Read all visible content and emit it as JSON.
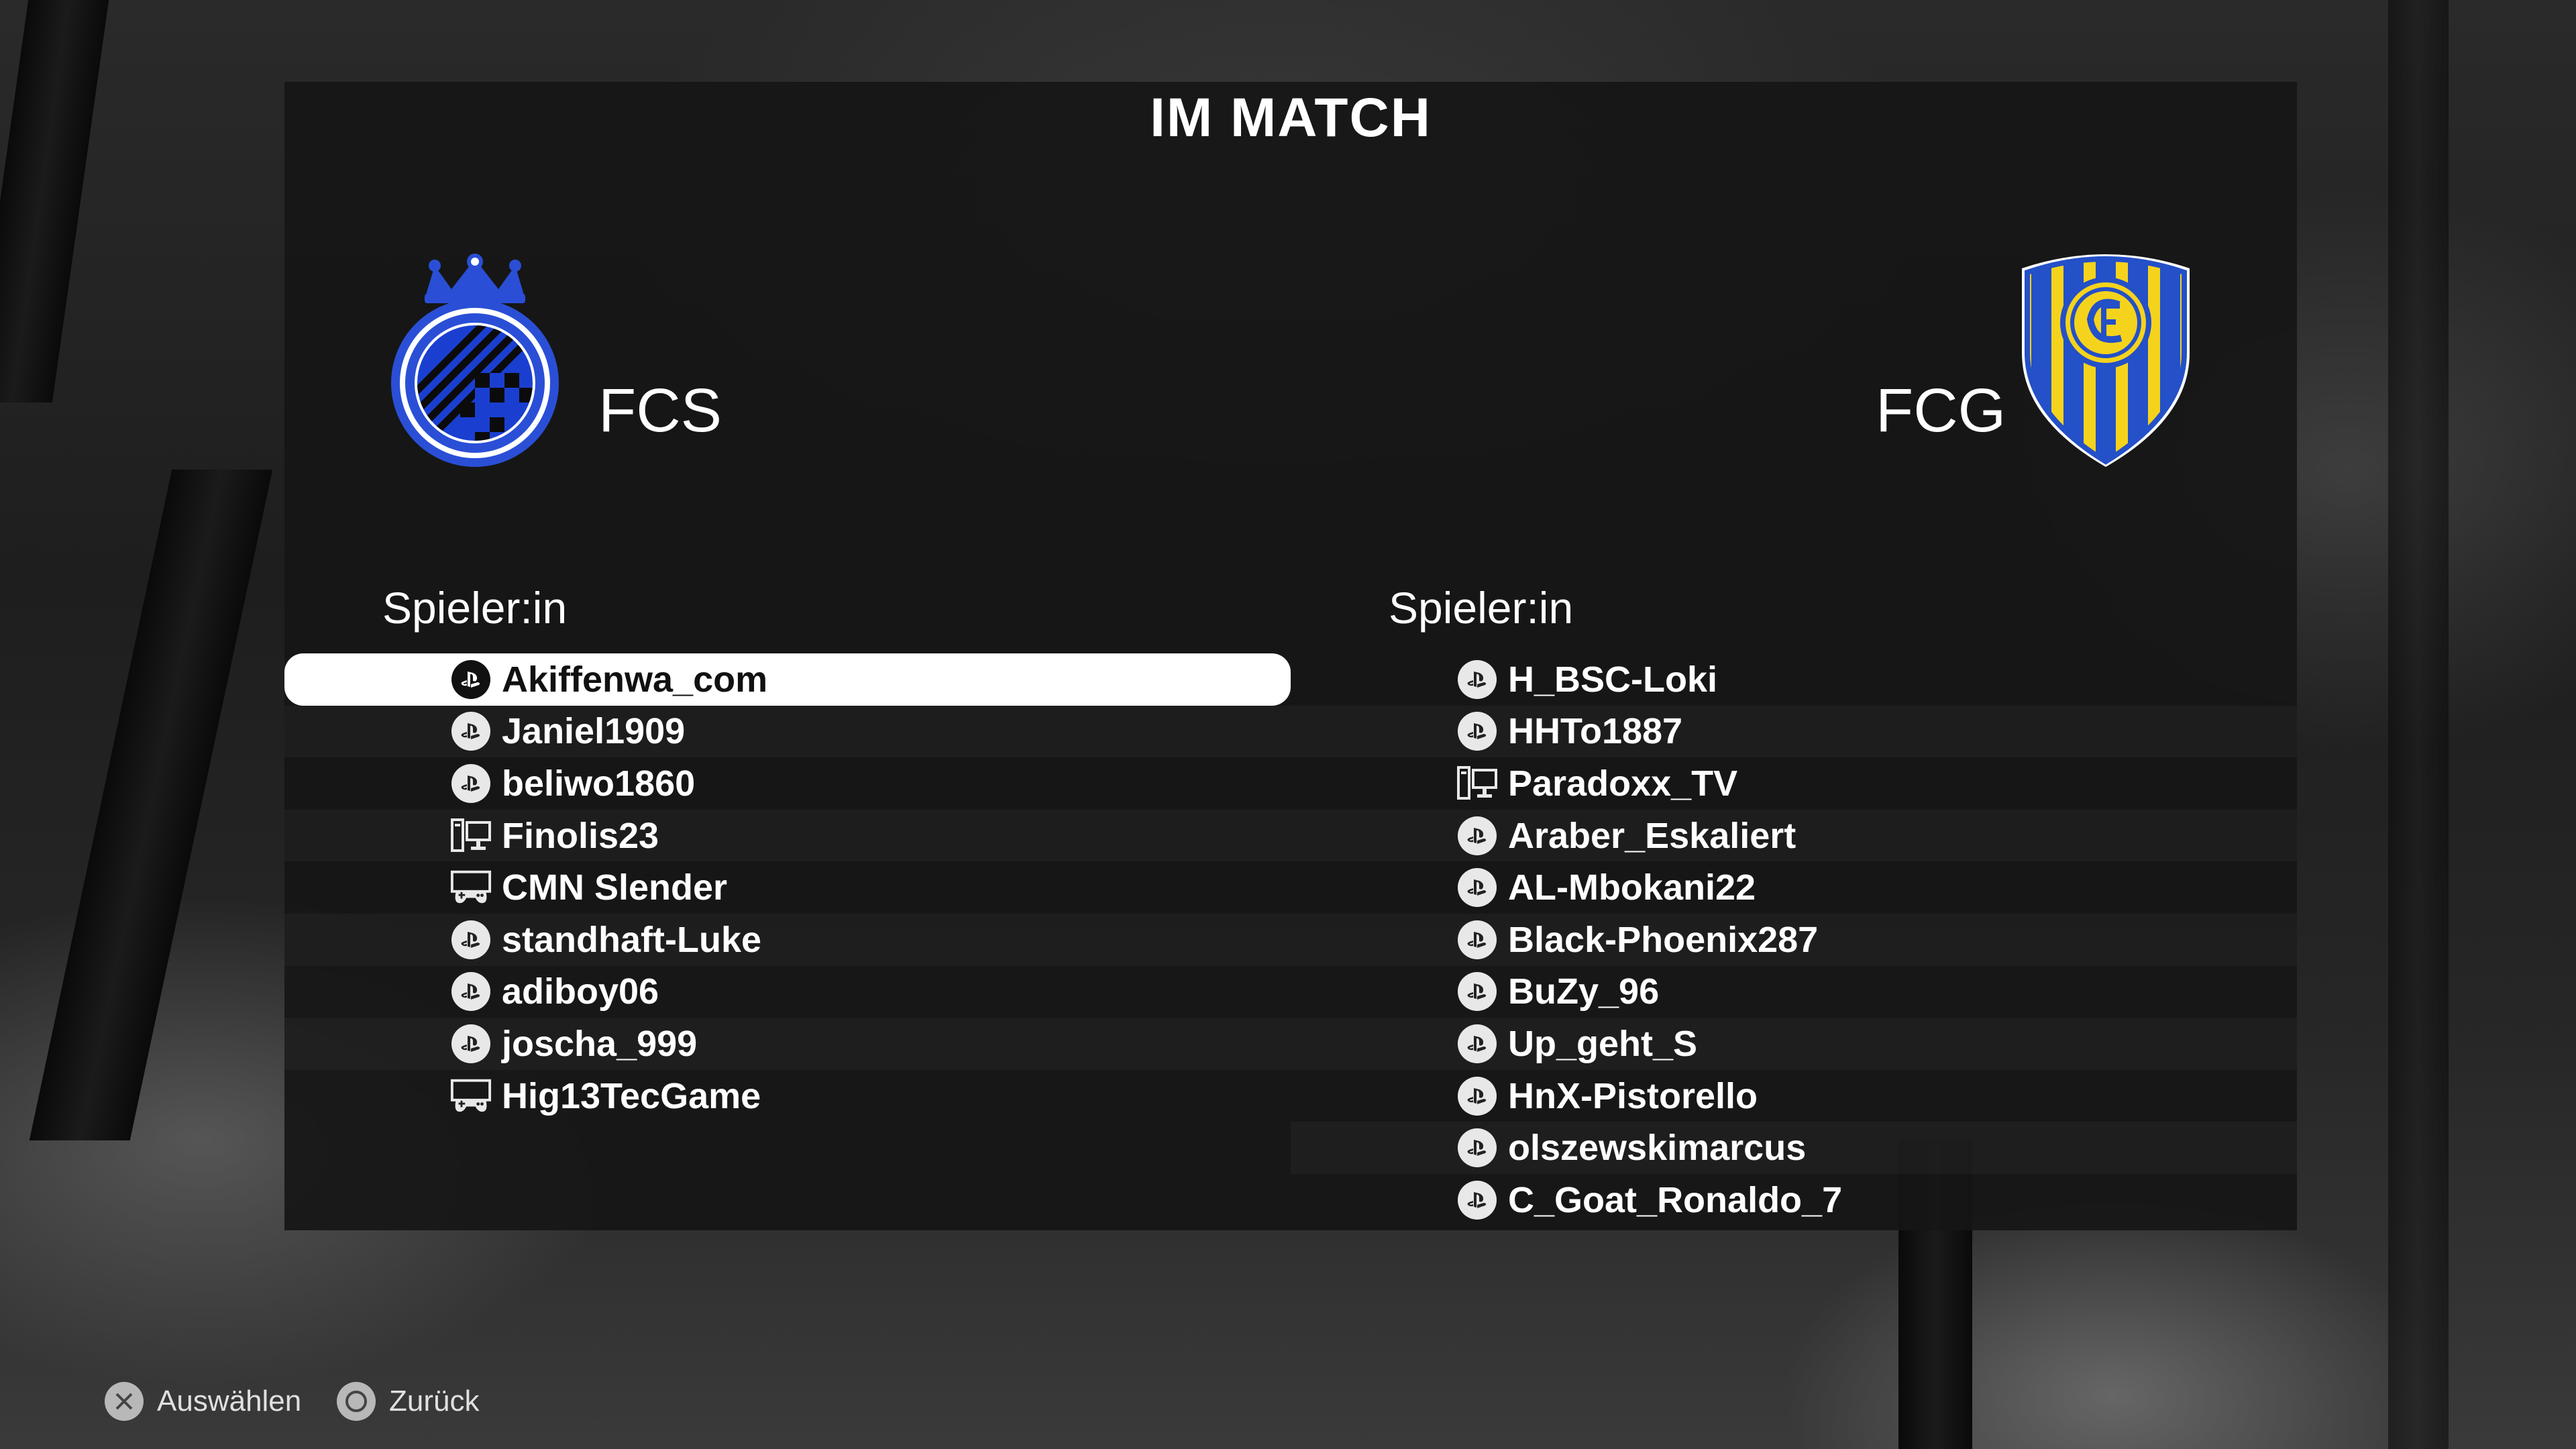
{
  "header": {
    "title": "IM MATCH"
  },
  "teams": {
    "home": {
      "name": "FCS",
      "players_label": "Spieler:in"
    },
    "away": {
      "name": "FCG",
      "players_label": "Spieler:in"
    }
  },
  "home_players": [
    {
      "name": "Akiffenwa_com",
      "platform": "playstation-icon",
      "selected": true
    },
    {
      "name": "Janiel1909",
      "platform": "playstation-icon"
    },
    {
      "name": "beliwo1860",
      "platform": "playstation-icon"
    },
    {
      "name": "Finolis23",
      "platform": "pc-icon"
    },
    {
      "name": "CMN Slender",
      "platform": "xbox-controller-icon"
    },
    {
      "name": "standhaft-Luke",
      "platform": "playstation-icon"
    },
    {
      "name": "adiboy06",
      "platform": "playstation-icon"
    },
    {
      "name": "joscha_999",
      "platform": "playstation-icon"
    },
    {
      "name": "Hig13TecGame",
      "platform": "xbox-controller-icon"
    }
  ],
  "away_players": [
    {
      "name": "H_BSC-Loki",
      "platform": "playstation-icon"
    },
    {
      "name": "HHTo1887",
      "platform": "playstation-icon"
    },
    {
      "name": "Paradoxx_TV",
      "platform": "pc-icon"
    },
    {
      "name": "Araber_Eskaliert",
      "platform": "playstation-icon"
    },
    {
      "name": "AL-Mbokani22",
      "platform": "playstation-icon"
    },
    {
      "name": "Black-Phoenix287",
      "platform": "playstation-icon"
    },
    {
      "name": "BuZy_96",
      "platform": "playstation-icon"
    },
    {
      "name": "Up_geht_S",
      "platform": "playstation-icon"
    },
    {
      "name": "HnX-Pistorello",
      "platform": "playstation-icon"
    },
    {
      "name": "olszewskimarcus",
      "platform": "playstation-icon"
    },
    {
      "name": "C_Goat_Ronaldo_7",
      "platform": "playstation-icon"
    }
  ],
  "footer": {
    "select_label": "Auswählen",
    "select_icon": "cross-button-icon",
    "back_label": "Zurück",
    "back_icon": "circle-button-icon"
  },
  "colors": {
    "home_crest_blue": "#2a4fd6",
    "away_crest_yellow": "#f5d31c",
    "away_crest_blue": "#2450c8"
  }
}
